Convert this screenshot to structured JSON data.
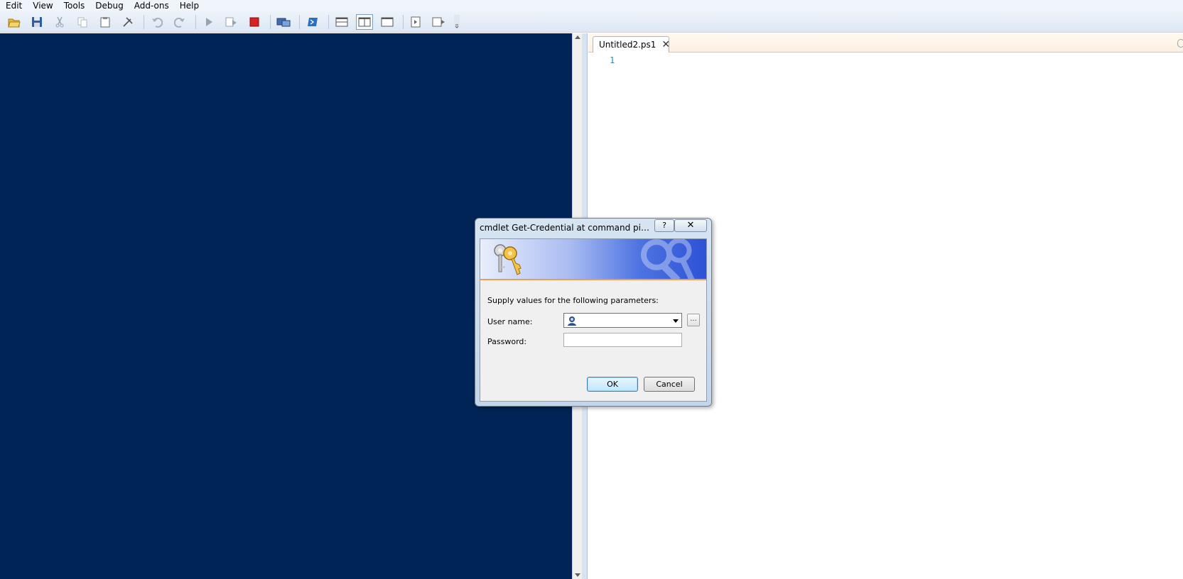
{
  "menu": {
    "items": [
      "Edit",
      "View",
      "Tools",
      "Debug",
      "Add-ons",
      "Help"
    ]
  },
  "toolbar": {
    "buttons": [
      "open-icon",
      "save-icon",
      "cut-icon",
      "copy-icon",
      "paste-icon",
      "clear-icon",
      "undo-icon",
      "redo-icon",
      "run-icon",
      "run-selection-icon",
      "stop-icon",
      "remote-icon",
      "powershell-icon",
      "layout-top-icon",
      "layout-right-icon",
      "layout-max-icon",
      "show-script-icon",
      "show-console-icon"
    ]
  },
  "editor": {
    "tab_label": "Untitled2.ps1",
    "tab_close": "✕",
    "line_number": "1"
  },
  "dialog": {
    "title": "cmdlet Get-Credential at command pipeline...",
    "help_glyph": "?",
    "close_glyph": "✕",
    "prompt": "Supply values for the following parameters:",
    "username_label": "User name:",
    "username_value": "",
    "password_label": "Password:",
    "password_value": "",
    "browse_label": "...",
    "ok_label": "OK",
    "cancel_label": "Cancel"
  },
  "colors": {
    "console_bg": "#012456",
    "accent_blue": "#3c7fb1",
    "stop_red": "#d62222",
    "line_number": "#2b91af"
  }
}
